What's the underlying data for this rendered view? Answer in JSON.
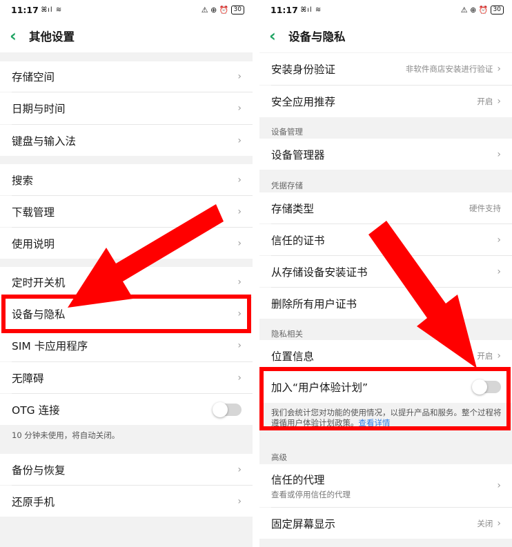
{
  "status": {
    "time": "11:17",
    "signal": "ꕤıl ≋",
    "icons": "⚠ ⊕ ⏰",
    "battery": "30"
  },
  "left": {
    "title": "其他设置",
    "rows": [
      "存储空间",
      "日期与时间",
      "键盘与输入法",
      "搜索",
      "下载管理",
      "使用说明",
      "定时开关机",
      "设备与隐私",
      "SIM 卡应用程序",
      "无障碍",
      "OTG 连接",
      "备份与恢复",
      "还原手机"
    ],
    "otg_note": "10 分钟未使用，将自动关闭。"
  },
  "right": {
    "title": "设备与隐私",
    "rows": {
      "install_verify": "安装身份验证",
      "install_verify_value": "非软件商店安装进行验证",
      "safe_app": "安全应用推荐",
      "safe_app_value": "开启",
      "device_mgr_section": "设备管理",
      "device_mgr": "设备管理器",
      "credential_section": "凭据存储",
      "storage_type": "存储类型",
      "storage_type_value": "硬件支持",
      "trusted_cert": "信任的证书",
      "install_cert": "从存储设备安装证书",
      "remove_cert": "删除所有用户证书",
      "privacy_section": "隐私相关",
      "location": "位置信息",
      "location_value": "开启",
      "ux_plan": "加入“用户体验计划”",
      "ux_note": "我们会统计您对功能的使用情况，以提升产品和服务。整个过程将遵循用户体验计划政策。",
      "ux_link": "查看详情",
      "advanced_section": "高级",
      "trusted_agent": "信任的代理",
      "trusted_agent_sub": "查看或停用信任的代理",
      "screen_pin": "固定屏幕显示",
      "screen_pin_value": "关闭"
    }
  },
  "colors": {
    "accent": "#1fa463",
    "highlight": "#ff0000",
    "link": "#2a7be4"
  }
}
